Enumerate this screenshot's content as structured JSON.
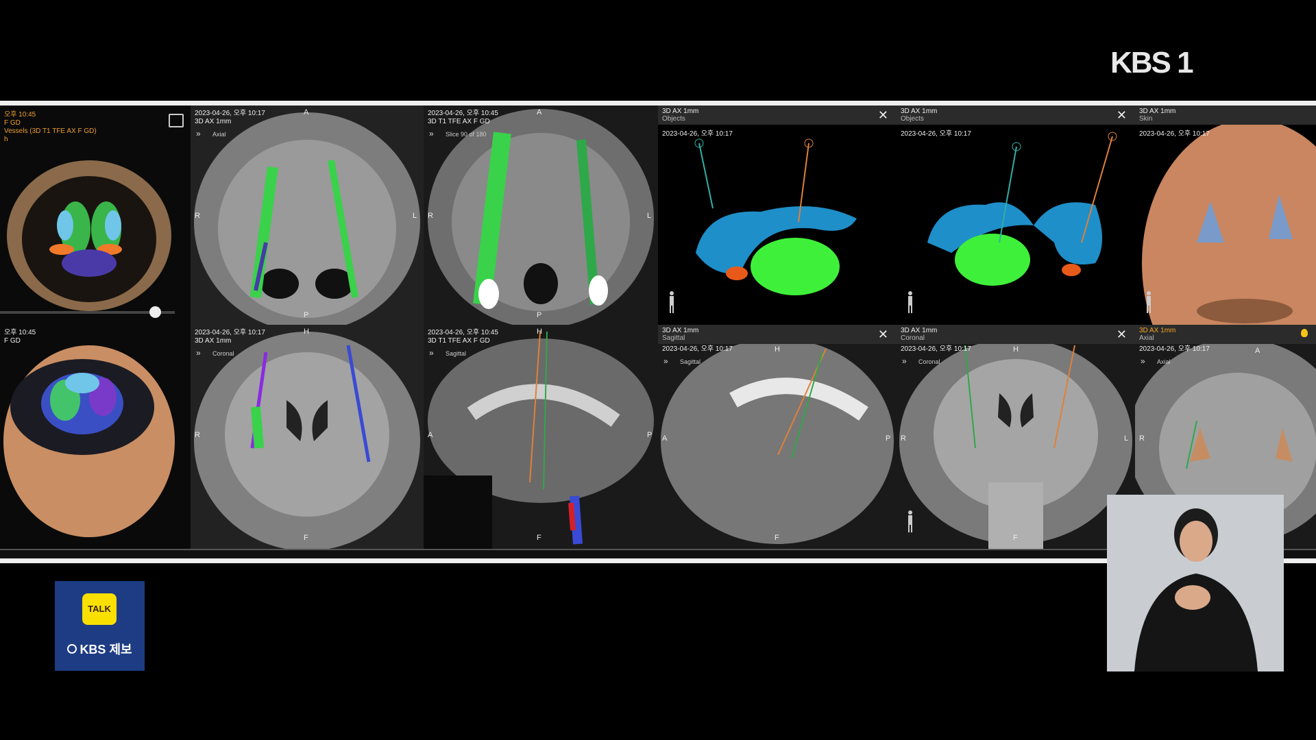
{
  "broadcast": {
    "channel_logo": "KBS 1"
  },
  "tip_button": {
    "badge": "TALK",
    "label": "KBS 제보"
  },
  "panels": {
    "p1": {
      "lines": [
        "오후 10:45",
        "F GD",
        "Vessels (3D T1 TFE AX F GD)",
        "h"
      ]
    },
    "p4": {
      "lines": [
        "오후 10:45",
        "F GD"
      ]
    },
    "p2": {
      "date": "2023-04-26, 오후 10:17",
      "series": "3D AX 1mm",
      "view": "Axial",
      "ori": [
        "A",
        "R",
        "L",
        "P"
      ]
    },
    "p5": {
      "date": "2023-04-26, 오후 10:17",
      "series": "3D AX 1mm",
      "view": "Coronal",
      "ori": [
        "H",
        "R",
        "F"
      ]
    },
    "p3": {
      "date": "2023-04-26, 오후 10:45",
      "series": "3D T1 TFE AX F GD",
      "view": "Slice 90 of 180",
      "ori": [
        "A",
        "R",
        "L",
        "P"
      ]
    },
    "p6": {
      "date": "2023-04-26, 오후 10:45",
      "series": "3D T1 TFE AX F GD",
      "view": "Sagittal",
      "ori": [
        "H",
        "A",
        "P",
        "F"
      ]
    },
    "p7": {
      "title": "3D AX 1mm",
      "sub": "Objects",
      "date": "2023-04-26, 오후 10:17"
    },
    "p8": {
      "title": "3D AX 1mm",
      "sub": "Objects",
      "date": "2023-04-26, 오후 10:17"
    },
    "p9": {
      "title": "3D AX 1mm",
      "sub": "Skin",
      "date": "2023-04-26, 오후 10:17"
    },
    "p10": {
      "title": "3D AX 1mm",
      "sub": "Sagittal",
      "date": "2023-04-26, 오후 10:17",
      "view": "Sagittal",
      "ori": [
        "H",
        "A",
        "P",
        "F"
      ]
    },
    "p11": {
      "title": "3D AX 1mm",
      "sub": "Coronal",
      "date": "2023-04-26, 오후 10:17",
      "view": "Coronal",
      "ori": [
        "H",
        "R",
        "L",
        "F"
      ]
    },
    "p12": {
      "title": "3D AX 1mm",
      "sub": "Axial",
      "date": "2023-04-26, 오후 10:17",
      "view": "Axial",
      "ori": [
        "A",
        "R"
      ]
    }
  },
  "close_glyph": "✕",
  "chevron_glyph": "»",
  "colors": {
    "panel_header": "#2b2b2b",
    "highlight": "#f5a623",
    "tip_bg": "#1d3c84",
    "talk_yellow": "#f9e000"
  }
}
